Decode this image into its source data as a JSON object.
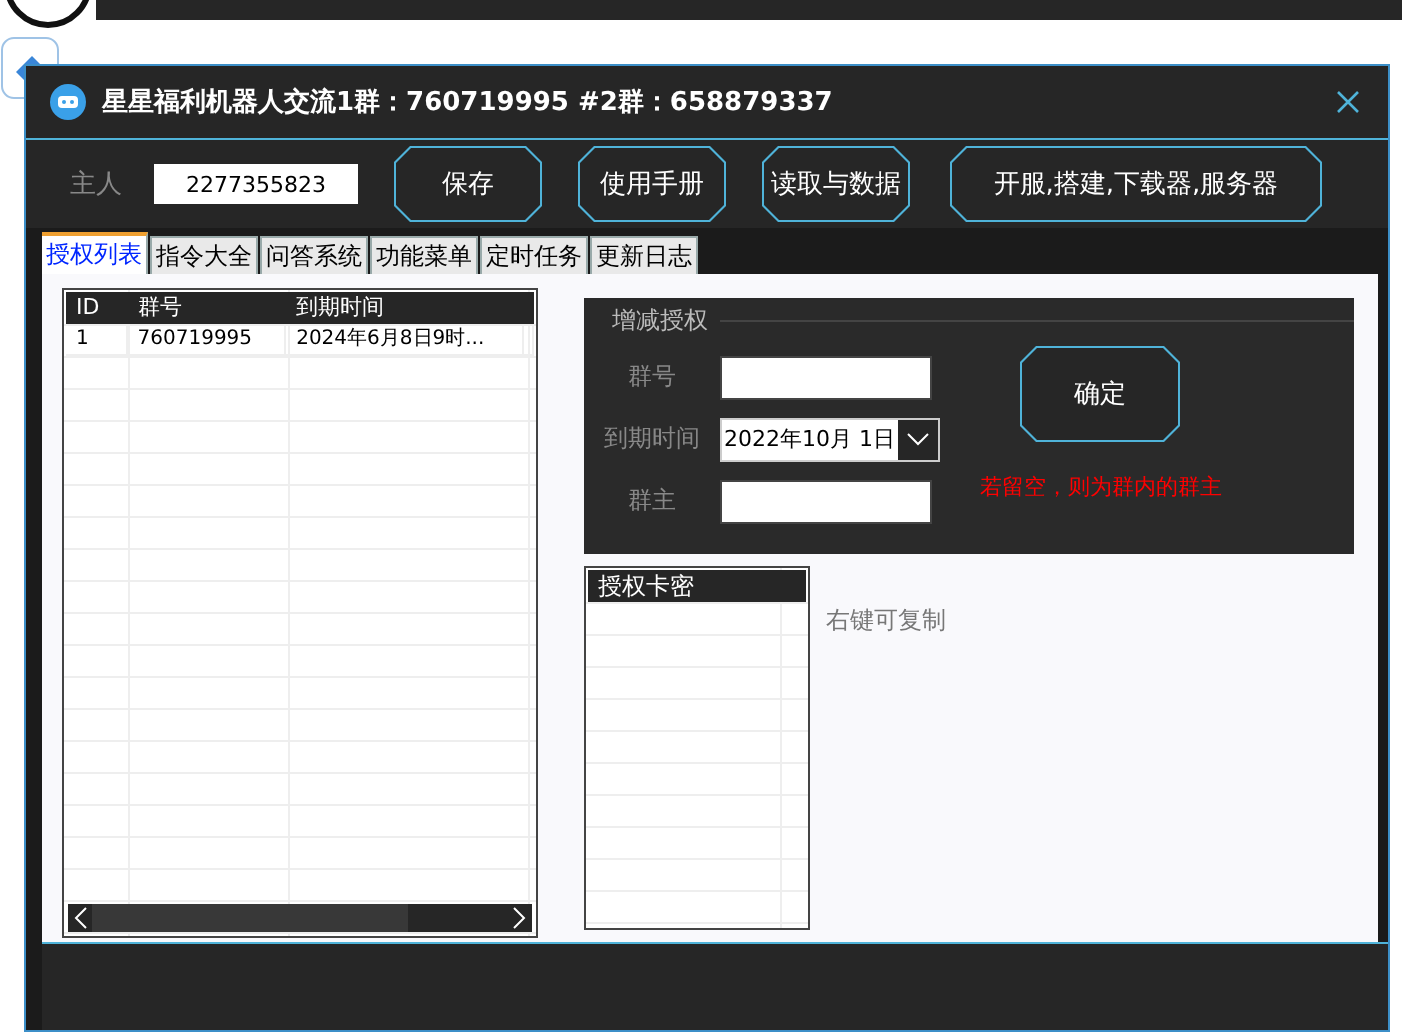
{
  "window": {
    "title": "星星福利机器人交流1群：760719995 #2群：658879337"
  },
  "toolbar": {
    "owner_label": "主人",
    "owner_value": "2277355823",
    "buttons": [
      "保存",
      "使用手册",
      "读取与数据",
      "开服,搭建,下载器,服务器"
    ]
  },
  "tabs": [
    {
      "label": "授权列表",
      "selected": true
    },
    {
      "label": "指令大全",
      "selected": false
    },
    {
      "label": "问答系统",
      "selected": false
    },
    {
      "label": "功能菜单",
      "selected": false
    },
    {
      "label": "定时任务",
      "selected": false
    },
    {
      "label": "更新日志",
      "selected": false
    }
  ],
  "table": {
    "columns": [
      "ID",
      "群号",
      "到期时间"
    ],
    "rows": [
      {
        "cells": [
          "1",
          "760719995",
          "2024年6月8日9时..."
        ]
      }
    ]
  },
  "auth_group": {
    "title": "增减授权",
    "group_label": "群号",
    "expiry_label": "到期时间",
    "expiry_value": "2022年10月 1日",
    "owner_label": "群主",
    "confirm": "确定",
    "hint": "若留空，则为群内的群主"
  },
  "card_list": {
    "header": "授权卡密",
    "hint": "右键可复制"
  }
}
